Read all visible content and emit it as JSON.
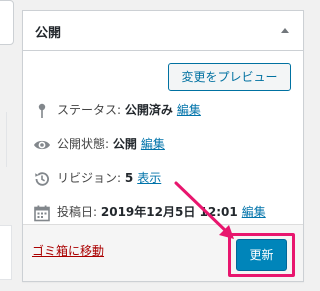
{
  "publish_box": {
    "title": "公開",
    "preview_label": "変更をプレビュー",
    "status": {
      "label": "ステータス:",
      "value": "公開済み",
      "edit_link": "編集"
    },
    "visibility": {
      "label": "公開状態:",
      "value": "公開",
      "edit_link": "編集"
    },
    "revisions": {
      "label": "リビジョン:",
      "value": "5",
      "link": "表示"
    },
    "published_on": {
      "label": "投稿日:",
      "value": "2019年12月5日 12:01",
      "edit_link": "編集"
    },
    "trash_link": "ゴミ箱に移動",
    "update_label": "更新"
  },
  "colors": {
    "accent": "#0085ba",
    "link": "#0073aa",
    "trash": "#aa0000",
    "annotation": "#e8166e"
  },
  "icons": [
    "toggle-up-icon",
    "pin-icon",
    "eye-icon",
    "history-icon",
    "calendar-icon"
  ]
}
